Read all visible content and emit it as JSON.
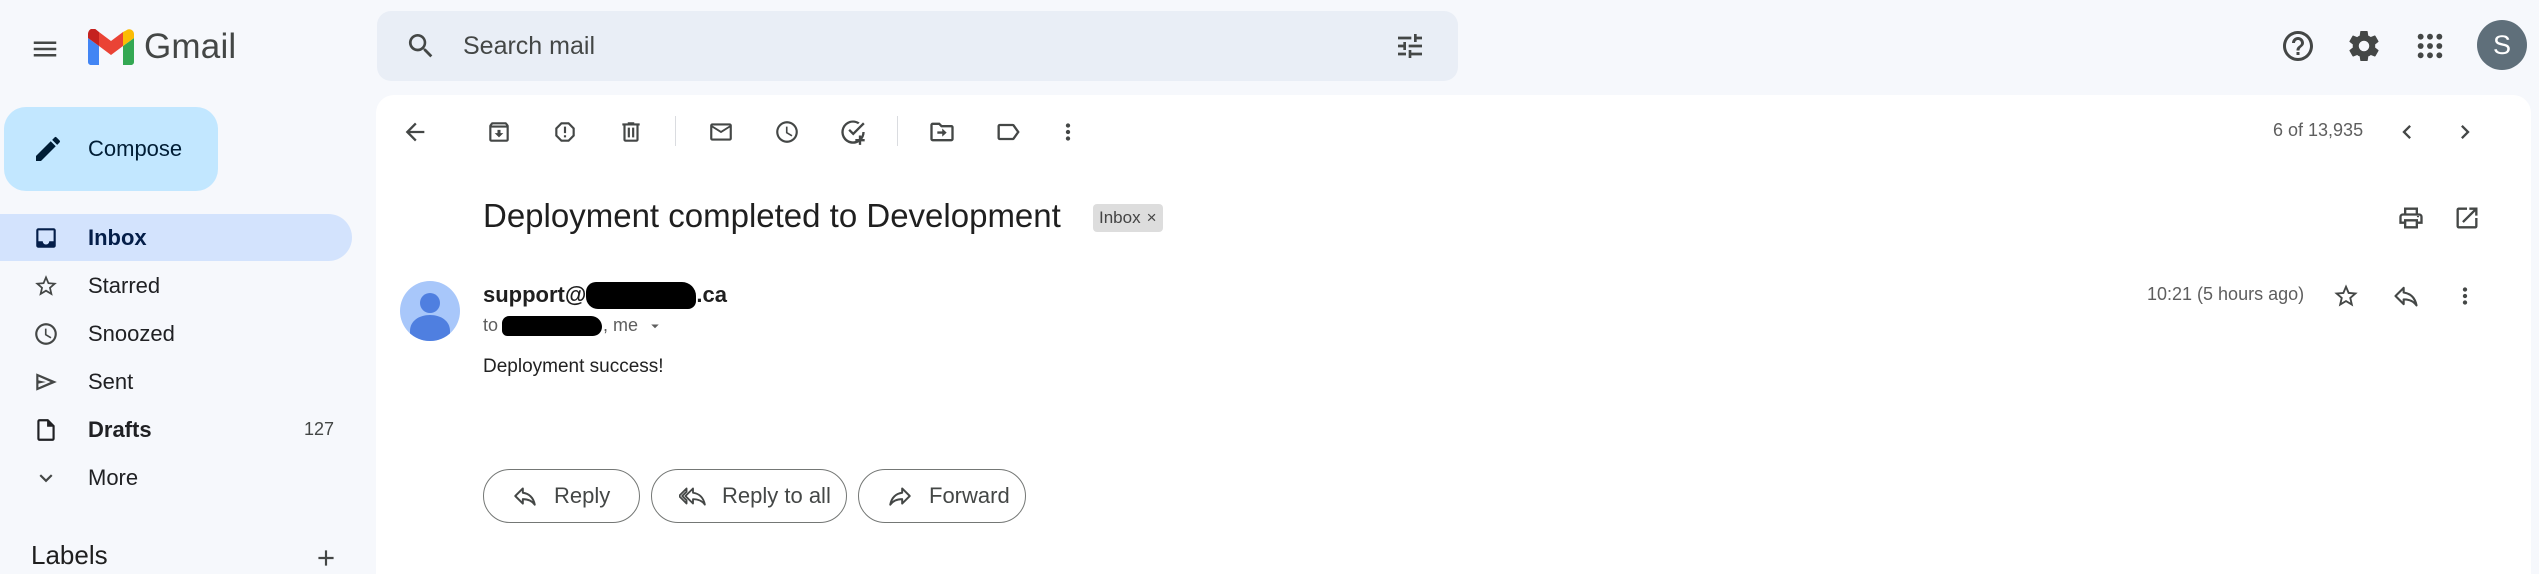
{
  "app": {
    "name": "Gmail"
  },
  "search": {
    "placeholder": "Search mail"
  },
  "account": {
    "initial": "S"
  },
  "compose": {
    "label": "Compose"
  },
  "sidebar": {
    "items": [
      {
        "label": "Inbox",
        "count": "",
        "icon": "inbox-icon",
        "active": true
      },
      {
        "label": "Starred",
        "count": "",
        "icon": "star-icon"
      },
      {
        "label": "Snoozed",
        "count": "",
        "icon": "clock-icon"
      },
      {
        "label": "Sent",
        "count": "",
        "icon": "send-icon"
      },
      {
        "label": "Drafts",
        "count": "127",
        "icon": "file-icon"
      },
      {
        "label": "More",
        "count": "",
        "icon": "chevron-down-icon"
      }
    ],
    "labels_title": "Labels"
  },
  "toolbar": {
    "pager": "6 of 13,935"
  },
  "email": {
    "subject": "Deployment completed to Development",
    "chip": "Inbox",
    "chip_close": "×",
    "sender_prefix": "support@",
    "sender_suffix": ".ca",
    "to_prefix": "to ",
    "to_suffix": ", me",
    "time": "10:21 (5 hours ago)",
    "body": "Deployment success!"
  },
  "actions": {
    "reply": "Reply",
    "reply_all": "Reply to all",
    "forward": "Forward"
  },
  "colors": {
    "background": "#f6f8fc",
    "compose": "#c2e7ff",
    "active_nav": "#d3e3fd",
    "search": "#e9eef6"
  }
}
